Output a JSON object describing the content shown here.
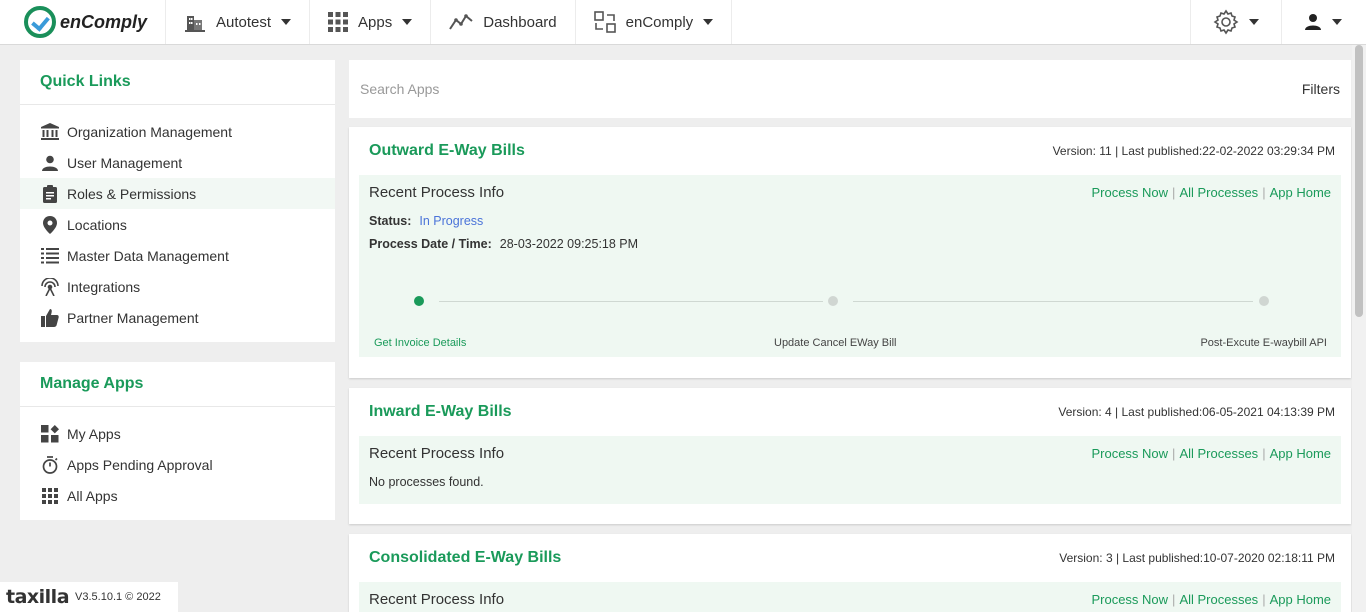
{
  "nav": {
    "brand": "enComply",
    "org": "Autotest",
    "apps": "Apps",
    "dashboard": "Dashboard",
    "product": "enComply"
  },
  "quick_links": {
    "title": "Quick Links",
    "items": [
      {
        "label": "Organization Management",
        "icon": "bank-icon"
      },
      {
        "label": "User Management",
        "icon": "user-icon"
      },
      {
        "label": "Roles & Permissions",
        "icon": "clipboard-icon"
      },
      {
        "label": "Locations",
        "icon": "location-pin-icon"
      },
      {
        "label": "Master Data Management",
        "icon": "data-list-icon"
      },
      {
        "label": "Integrations",
        "icon": "antenna-icon"
      },
      {
        "label": "Partner Management",
        "icon": "thumbs-up-icon"
      }
    ]
  },
  "manage_apps": {
    "title": "Manage Apps",
    "items": [
      {
        "label": "My Apps",
        "icon": "widgets-icon"
      },
      {
        "label": "Apps Pending Approval",
        "icon": "timer-icon"
      },
      {
        "label": "All Apps",
        "icon": "grid-icon"
      }
    ]
  },
  "search": {
    "placeholder": "Search Apps",
    "filters": "Filters"
  },
  "link_labels": {
    "process_now": "Process Now",
    "all_processes": "All Processes",
    "app_home": "App Home",
    "separator": "|"
  },
  "cards": [
    {
      "title": "Outward E-Way Bills",
      "version": "Version: 11 | Last published:22-02-2022 03:29:34 PM",
      "recent_title": "Recent Process Info",
      "status_label": "Status:",
      "status_value": "In Progress",
      "date_label": "Process Date / Time:",
      "date_value": "28-03-2022 09:25:18 PM",
      "steps": [
        "Get Invoice Details",
        "Update Cancel EWay Bill",
        "Post-Excute E-waybill API"
      ]
    },
    {
      "title": "Inward E-Way Bills",
      "version": "Version: 4 | Last published:06-05-2021 04:13:39 PM",
      "recent_title": "Recent Process Info",
      "empty": "No processes found."
    },
    {
      "title": "Consolidated E-Way Bills",
      "version": "Version: 3 | Last published:10-07-2020 02:18:11 PM",
      "recent_title": "Recent Process Info"
    }
  ],
  "footer": {
    "logo": "taxilla",
    "version": "V3.5.10.1 © 2022"
  },
  "colors": {
    "accent": "#1a9a5a",
    "status": "#4a73d9",
    "active_step": "#1a9a5a",
    "pending_step": "#d0d6d2"
  }
}
